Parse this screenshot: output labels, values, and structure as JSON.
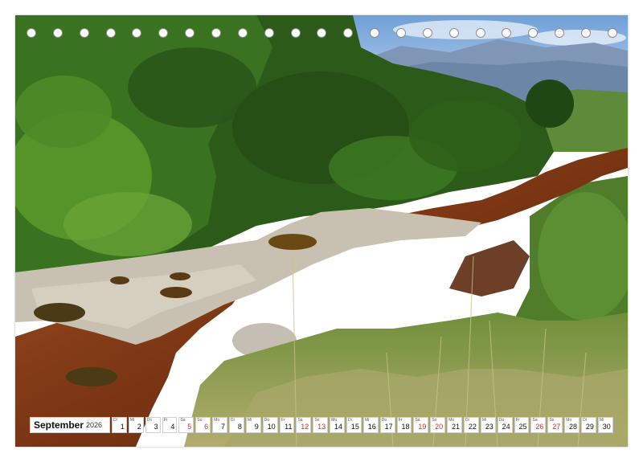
{
  "calendar": {
    "month": "September",
    "year": "2026",
    "days": [
      {
        "wd": "Di",
        "n": "1"
      },
      {
        "wd": "Mi",
        "n": "2"
      },
      {
        "wd": "Do",
        "n": "3"
      },
      {
        "wd": "Fr",
        "n": "4"
      },
      {
        "wd": "Sa",
        "n": "5"
      },
      {
        "wd": "So",
        "n": "6"
      },
      {
        "wd": "Mo",
        "n": "7"
      },
      {
        "wd": "Di",
        "n": "8"
      },
      {
        "wd": "Mi",
        "n": "9"
      },
      {
        "wd": "Do",
        "n": "10"
      },
      {
        "wd": "Fr",
        "n": "11"
      },
      {
        "wd": "Sa",
        "n": "12"
      },
      {
        "wd": "So",
        "n": "13"
      },
      {
        "wd": "Mo",
        "n": "14"
      },
      {
        "wd": "Di",
        "n": "15"
      },
      {
        "wd": "Mi",
        "n": "16"
      },
      {
        "wd": "Do",
        "n": "17"
      },
      {
        "wd": "Fr",
        "n": "18"
      },
      {
        "wd": "Sa",
        "n": "19"
      },
      {
        "wd": "So",
        "n": "20"
      },
      {
        "wd": "Mo",
        "n": "21"
      },
      {
        "wd": "Di",
        "n": "22"
      },
      {
        "wd": "Mi",
        "n": "23"
      },
      {
        "wd": "Do",
        "n": "24"
      },
      {
        "wd": "Fr",
        "n": "25"
      },
      {
        "wd": "Sa",
        "n": "26"
      },
      {
        "wd": "So",
        "n": "27"
      },
      {
        "wd": "Mo",
        "n": "28"
      },
      {
        "wd": "Di",
        "n": "29"
      },
      {
        "wd": "Mi",
        "n": "30"
      }
    ]
  },
  "binding": {
    "hole_count": 23
  },
  "colors": {
    "sky": "#9fc3e8",
    "mountains": "#7d94b5",
    "foliage_dark": "#1f4a14",
    "foliage_mid": "#3f7a22",
    "foliage_light": "#7fb23a",
    "rock": "#c9c2b3",
    "water": "#8a3d14",
    "grass": "#9aa45a"
  }
}
